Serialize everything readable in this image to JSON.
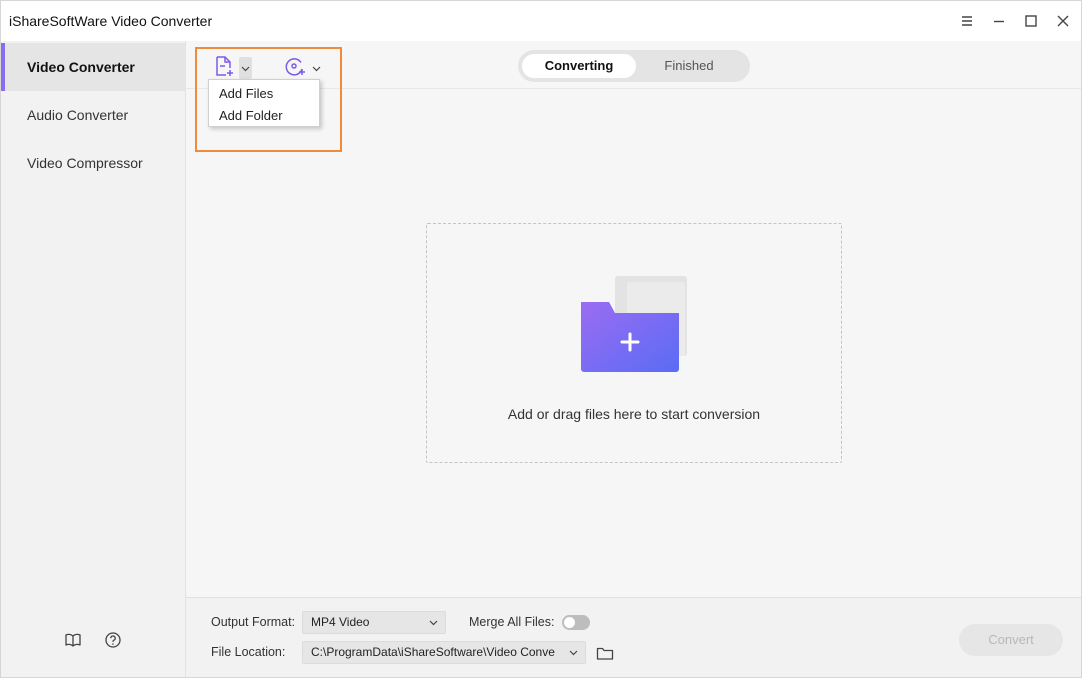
{
  "app": {
    "title": "iShareSoftWare Video Converter"
  },
  "window_controls": [
    "menu-icon",
    "minimize-icon",
    "maximize-icon",
    "close-icon"
  ],
  "sidebar": {
    "items": [
      {
        "label": "Video Converter",
        "active": true
      },
      {
        "label": "Audio Converter",
        "active": false
      },
      {
        "label": "Video Compressor",
        "active": false
      }
    ],
    "bottom_icons": [
      "book-icon",
      "help-icon"
    ]
  },
  "toolbar": {
    "add_file_icon": "add-file-icon",
    "add_dvd_icon": "add-dvd-icon",
    "dropdown": {
      "items": [
        "Add Files",
        "Add Folder"
      ]
    },
    "tabs": [
      {
        "label": "Converting",
        "active": true
      },
      {
        "label": "Finished",
        "active": false
      }
    ]
  },
  "dropzone": {
    "text": "Add or drag files here to start conversion"
  },
  "bottom": {
    "output_format_label": "Output Format:",
    "output_format_value": "MP4 Video",
    "merge_label": "Merge All Files:",
    "merge_on": false,
    "file_location_label": "File Location:",
    "file_location_value": "C:\\ProgramData\\iShareSoftware\\Video Conve",
    "convert_label": "Convert"
  },
  "colors": {
    "accent": "#8a6cf0",
    "highlight": "#f08a3c",
    "folder_gradient_start": "#9b6cf2",
    "folder_gradient_end": "#5a6cf5"
  }
}
